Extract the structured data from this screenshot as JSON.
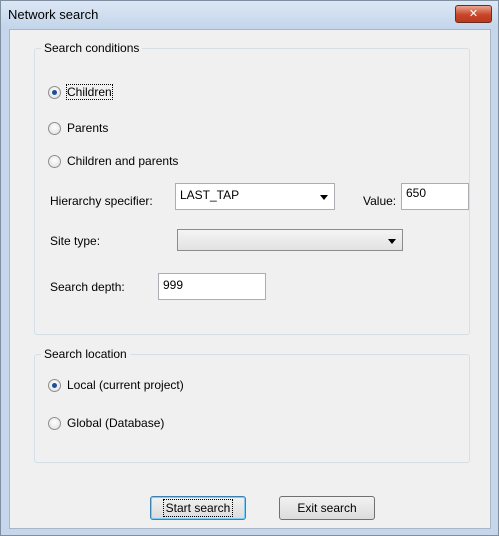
{
  "window": {
    "title": "Network search",
    "close_icon": "close-icon"
  },
  "search_conditions": {
    "legend": "Search conditions",
    "options": [
      {
        "label": "Children",
        "checked": true
      },
      {
        "label": "Parents",
        "checked": false
      },
      {
        "label": "Children and parents",
        "checked": false
      }
    ],
    "hierarchy_label": "Hierarchy specifier:",
    "hierarchy_value": "LAST_TAP",
    "value_label": "Value:",
    "value_value": "650",
    "site_type_label": "Site type:",
    "site_type_value": "",
    "depth_label": "Search depth:",
    "depth_value": "999"
  },
  "search_location": {
    "legend": "Search location",
    "options": [
      {
        "label": "Local (current project)",
        "checked": true
      },
      {
        "label": "Global (Database)",
        "checked": false
      }
    ]
  },
  "buttons": {
    "start": "Start search",
    "exit": "Exit search"
  },
  "colors": {
    "close_button": "#c9452a",
    "radio_dot": "#1e4c9a",
    "default_button_border": "#3c7fb1"
  }
}
